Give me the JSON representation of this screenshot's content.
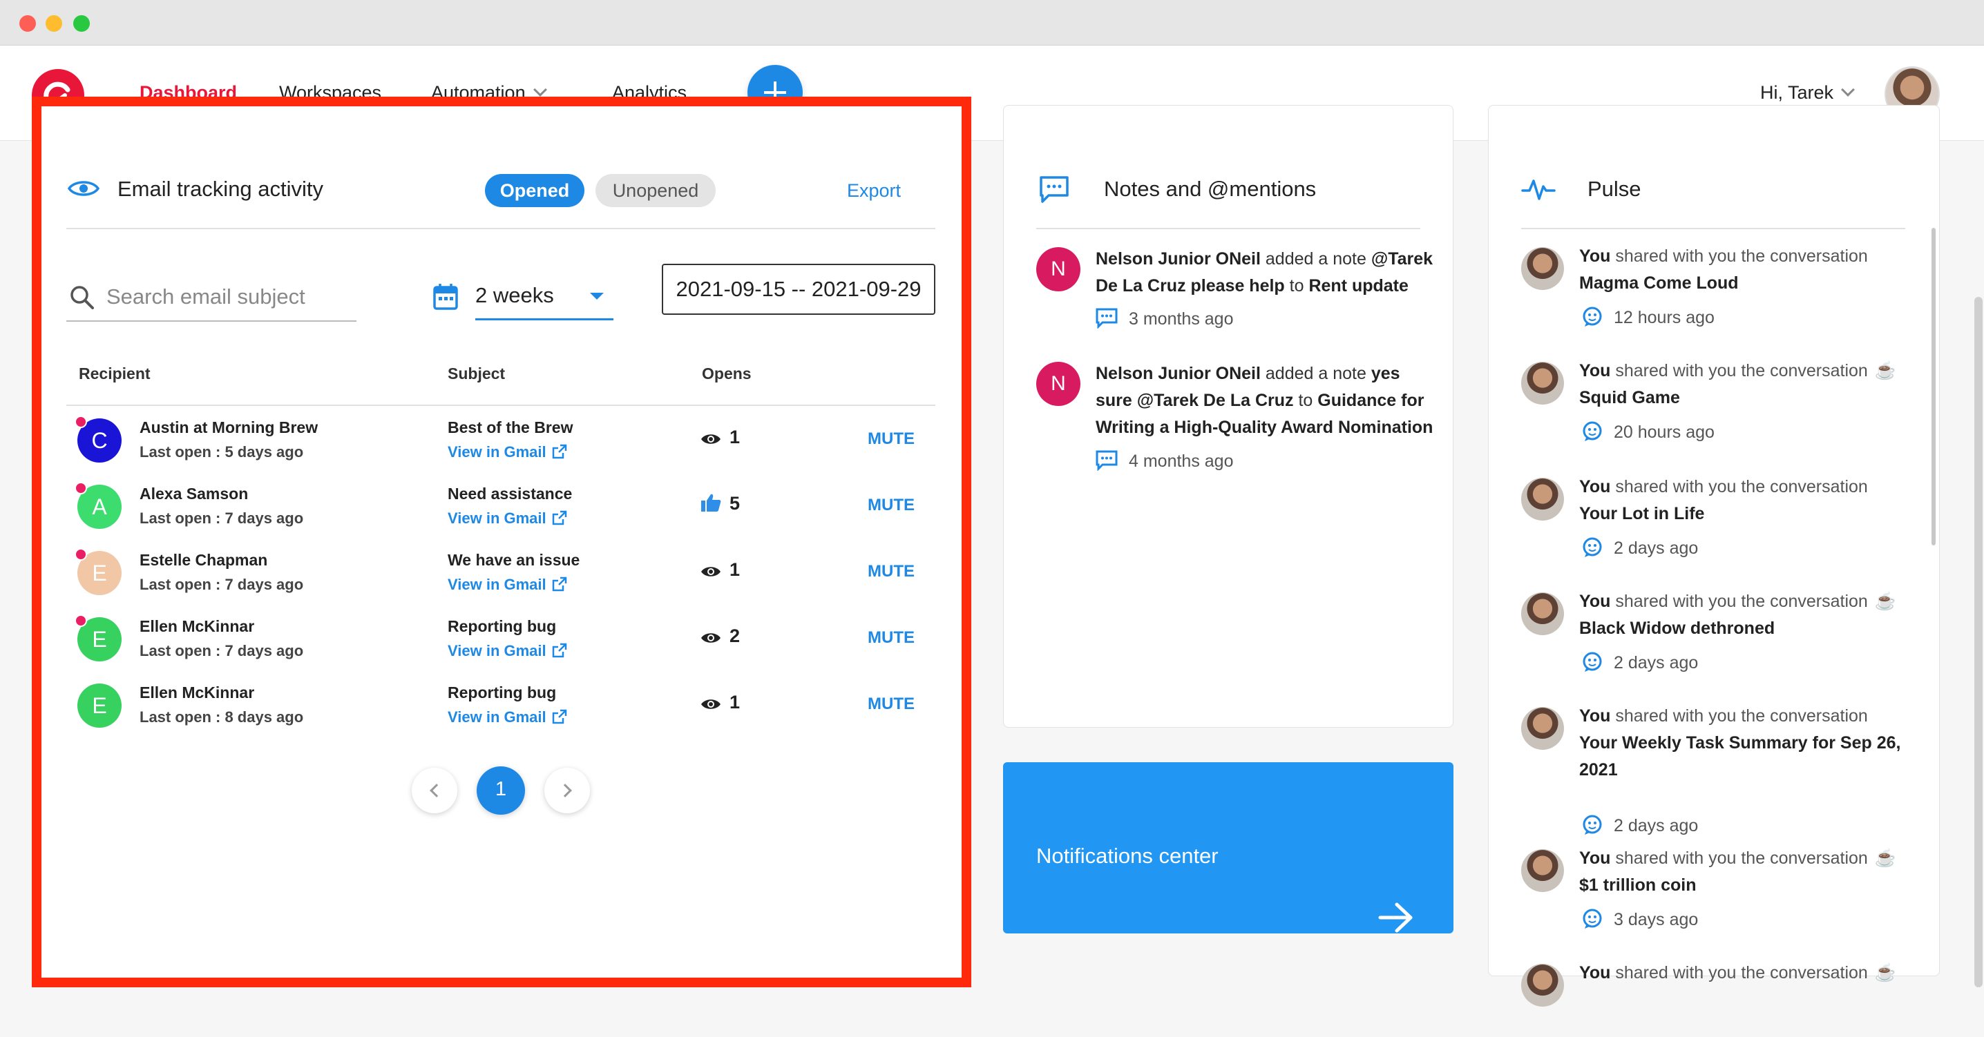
{
  "nav": {
    "items": [
      "Dashboard",
      "Workspaces",
      "Automation",
      "Analytics"
    ],
    "greeting": "Hi, Tarek"
  },
  "email_tracking": {
    "title": "Email tracking activity",
    "tabs": [
      "Opened",
      "Unopened"
    ],
    "export_label": "Export",
    "search_placeholder": "Search email subject",
    "range": "2 weeks",
    "date_range": "2021-09-15 -- 2021-09-29",
    "columns": [
      "Recipient",
      "Subject",
      "Opens"
    ],
    "rows": [
      {
        "initial": "C",
        "color": "#1a15d6",
        "name": "Austin at Morning Brew",
        "last_open": "Last open : 5 days ago",
        "subject": "Best of the Brew",
        "gmail": "View in Gmail",
        "opens": "1",
        "icon": "eye",
        "mute": "MUTE",
        "dot": true
      },
      {
        "initial": "A",
        "color": "#3ddc6e",
        "name": "Alexa Samson",
        "last_open": "Last open : 7 days ago",
        "subject": "Need assistance",
        "gmail": "View in Gmail",
        "opens": "5",
        "icon": "thumb",
        "mute": "MUTE",
        "dot": true
      },
      {
        "initial": "E",
        "color": "#f1c7a6",
        "name": "Estelle Chapman",
        "last_open": "Last open : 7 days ago",
        "subject": "We have an issue",
        "gmail": "View in Gmail",
        "opens": "1",
        "icon": "eye",
        "mute": "MUTE",
        "dot": true
      },
      {
        "initial": "E",
        "color": "#36d15e",
        "name": "Ellen McKinnar",
        "last_open": "Last open : 7 days ago",
        "subject": "Reporting bug",
        "gmail": "View in Gmail",
        "opens": "2",
        "icon": "eye",
        "mute": "MUTE",
        "dot": true
      },
      {
        "initial": "E",
        "color": "#36d15e",
        "name": "Ellen McKinnar",
        "last_open": "Last open : 8 days ago",
        "subject": "Reporting bug",
        "gmail": "View in Gmail",
        "opens": "1",
        "icon": "eye",
        "mute": "MUTE",
        "dot": false
      }
    ],
    "current_page": "1"
  },
  "notes": {
    "title": "Notes and @mentions",
    "items": [
      {
        "initial": "N",
        "author": "Nelson Junior ONeil",
        "action": " added a note ",
        "content": "@Tarek De La Cruz please help",
        "connector": " to ",
        "target": "Rent update",
        "time": "3 months ago"
      },
      {
        "initial": "N",
        "author": "Nelson Junior ONeil",
        "action": " added a note ",
        "content": "yes sure @Tarek De La Cruz ",
        "connector": " to ",
        "target": "Guidance for Writing a High-Quality Award Nomination",
        "time": "4 months ago"
      }
    ]
  },
  "pulse": {
    "title": "Pulse",
    "items": [
      {
        "who": "You",
        "text": " shared with you the conversation",
        "emoji": "",
        "title": "Magma Come Loud",
        "time": "12 hours ago"
      },
      {
        "who": "You",
        "text": " shared with you the conversation",
        "emoji": "☕",
        "title": "Squid Game",
        "time": "20 hours ago"
      },
      {
        "who": "You",
        "text": " shared with you the conversation",
        "emoji": "",
        "title": "Your Lot in Life",
        "time": "2 days ago"
      },
      {
        "who": "You",
        "text": " shared with you the conversation",
        "emoji": "☕",
        "title": "Black Widow dethroned",
        "time": "2 days ago"
      },
      {
        "who": "You",
        "text": " shared with you the conversation",
        "emoji": "",
        "title": "Your Weekly Task Summary for Sep 26, 2021",
        "time": "2 days ago"
      },
      {
        "who": "You",
        "text": " shared with you the conversation",
        "emoji": "☕",
        "title": "$1 trillion coin",
        "time": "3 days ago"
      },
      {
        "who": "You",
        "text": " shared with you the conversation",
        "emoji": "☕",
        "title": "",
        "time": ""
      }
    ]
  },
  "notifications": {
    "title": "Notifications center"
  }
}
